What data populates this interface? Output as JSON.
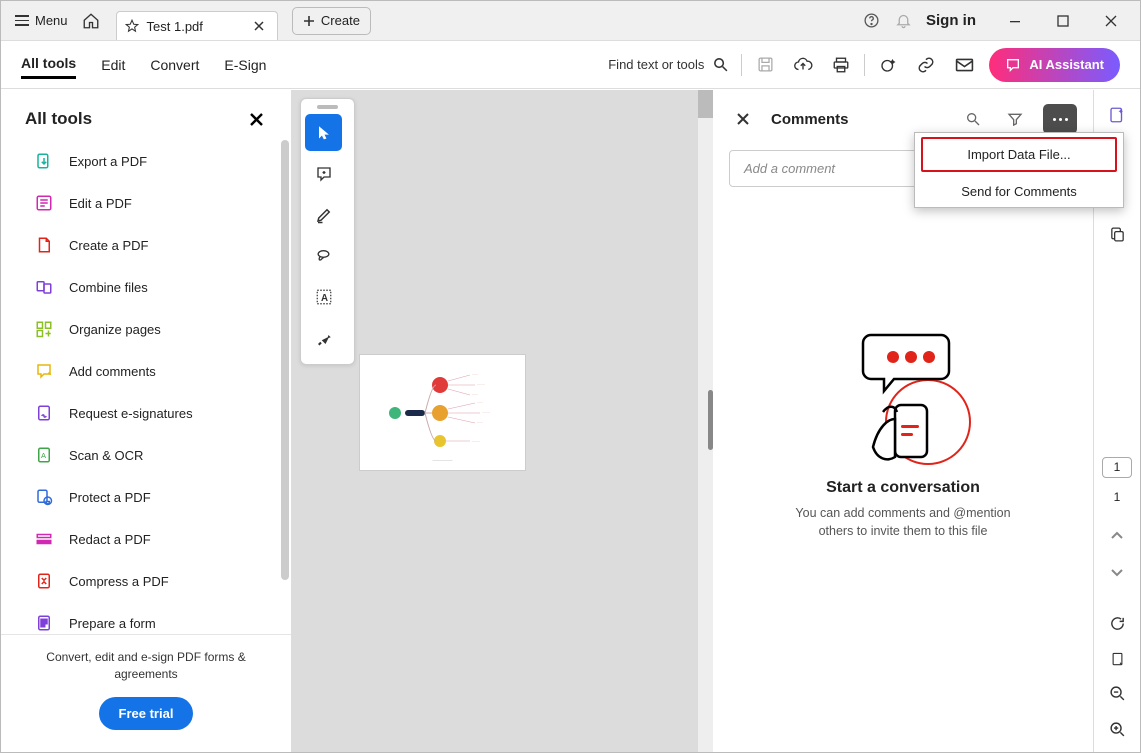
{
  "titlebar": {
    "menu": "Menu",
    "tab_name": "Test 1.pdf",
    "create": "Create"
  },
  "window": {
    "sign_in": "Sign in"
  },
  "toolbar": {
    "tabs": [
      "All tools",
      "Edit",
      "Convert",
      "E-Sign"
    ],
    "find": "Find text or tools",
    "ai": "AI Assistant"
  },
  "sidebar": {
    "title": "All tools",
    "items": [
      "Export a PDF",
      "Edit a PDF",
      "Create a PDF",
      "Combine files",
      "Organize pages",
      "Add comments",
      "Request e-signatures",
      "Scan & OCR",
      "Protect a PDF",
      "Redact a PDF",
      "Compress a PDF",
      "Prepare a form"
    ],
    "footer": "Convert, edit and e-sign PDF forms & agreements",
    "trial": "Free trial"
  },
  "comments": {
    "title": "Comments",
    "placeholder": "Add a comment",
    "empty_title": "Start a conversation",
    "empty_desc": "You can add comments and @mention others to invite them to this file"
  },
  "dropdown": {
    "import": "Import Data File...",
    "send": "Send for Comments"
  },
  "rightrail": {
    "page_current": "1",
    "page_total": "1"
  }
}
